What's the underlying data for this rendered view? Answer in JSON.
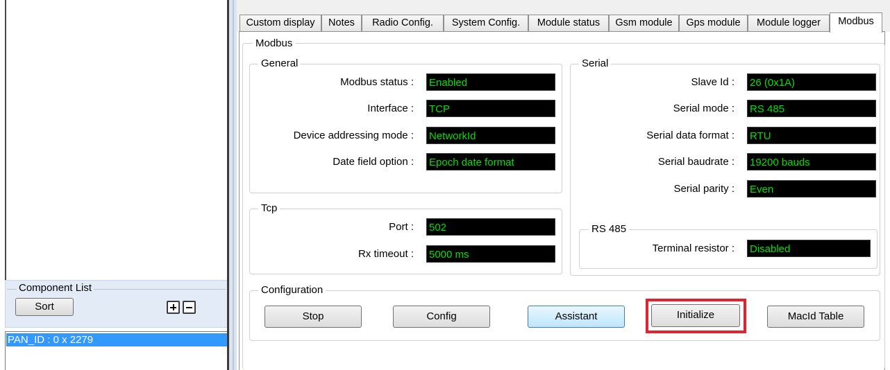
{
  "component_list": {
    "title": "Component List",
    "sort_label": "Sort",
    "selected_item": "PAN_ID : 0 x 2279"
  },
  "tabs": [
    {
      "label": "Custom display"
    },
    {
      "label": "Notes"
    },
    {
      "label": "Radio Config."
    },
    {
      "label": "System Config."
    },
    {
      "label": "Module status"
    },
    {
      "label": "Gsm module"
    },
    {
      "label": "Gps module"
    },
    {
      "label": "Module logger"
    },
    {
      "label": "Modbus",
      "active": true
    }
  ],
  "modbus": {
    "title": "Modbus",
    "general": {
      "title": "General",
      "status_label": "Modbus status :",
      "status_value": "Enabled",
      "interface_label": "Interface :",
      "interface_value": "TCP",
      "addressing_label": "Device addressing mode :",
      "addressing_value": "NetworkId",
      "date_label": "Date field option :",
      "date_value": "Epoch date format"
    },
    "tcp": {
      "title": "Tcp",
      "port_label": "Port :",
      "port_value": "502",
      "rx_label": "Rx timeout :",
      "rx_value": "5000 ms"
    },
    "serial": {
      "title": "Serial",
      "slave_label": "Slave Id :",
      "slave_value": "26 (0x1A)",
      "mode_label": "Serial mode :",
      "mode_value": "RS 485",
      "format_label": "Serial data format :",
      "format_value": "RTU",
      "baud_label": "Serial baudrate :",
      "baud_value": "19200 bauds",
      "parity_label": "Serial parity :",
      "parity_value": "Even"
    },
    "rs485": {
      "title": "RS 485",
      "terminal_label": "Terminal resistor :",
      "terminal_value": "Disabled"
    },
    "configuration": {
      "title": "Configuration",
      "stop_label": "Stop",
      "config_label": "Config",
      "assistant_label": "Assistant",
      "initialize_label": "Initialize",
      "macid_label": "MacId Table"
    }
  },
  "colors": {
    "value_bg": "#000000",
    "value_text": "#00e000",
    "highlight_frame": "#e8202c",
    "selection": "#3399ff"
  }
}
